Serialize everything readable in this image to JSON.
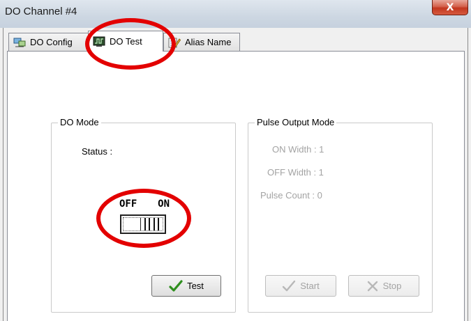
{
  "window": {
    "title": "DO Channel #4",
    "close_label": "X"
  },
  "tabs": [
    {
      "label": "DO Config",
      "icon": "network-icon",
      "active": false
    },
    {
      "label": "DO Test",
      "icon": "monitor-icon",
      "active": true
    },
    {
      "label": "Alias Name",
      "icon": "notepad-icon",
      "active": false
    }
  ],
  "do_mode": {
    "title": "DO Mode",
    "status_label": "Status :",
    "switch_off_label": "OFF",
    "switch_on_label": "ON",
    "switch_state": "ON",
    "test_button": "Test"
  },
  "pulse_mode": {
    "title": "Pulse Output Mode",
    "on_width": "ON Width : 1",
    "off_width": "OFF Width : 1",
    "pulse_count": "Pulse Count : 0",
    "start_button": "Start",
    "stop_button": "Stop",
    "enabled": false
  },
  "colors": {
    "annotation": "#e30000",
    "disabled_text": "#a3a3a3"
  }
}
